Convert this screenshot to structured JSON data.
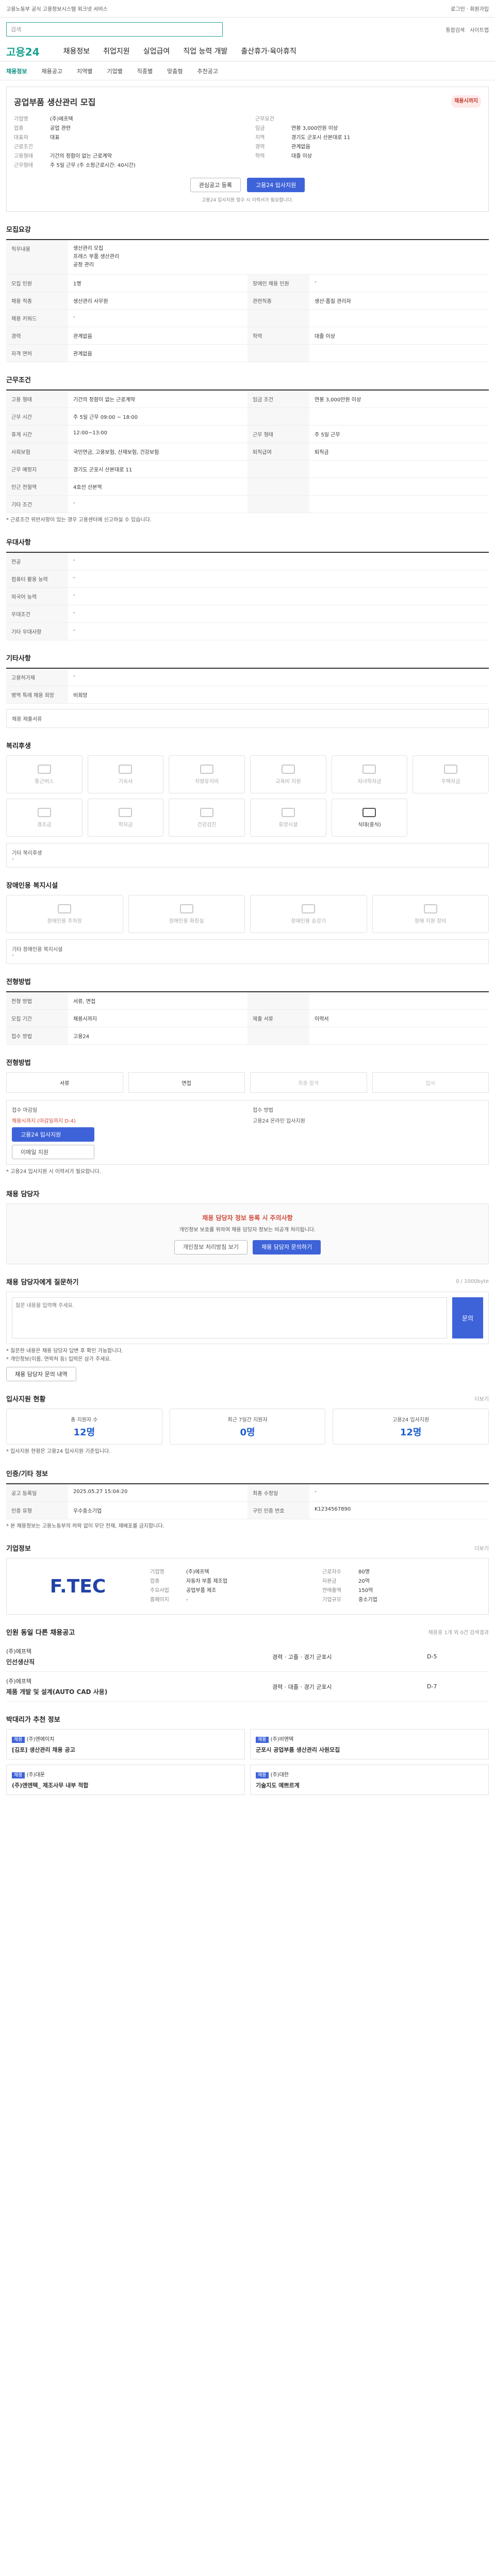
{
  "topbar": {
    "notice": "고용노동부 공식 고용정보시스템 워크넷 서비스",
    "right": "로그인 · 회원가입"
  },
  "search": {
    "placeholder": "검색"
  },
  "header": {
    "logo": "고용24",
    "menu": [
      "채용정보",
      "취업지원",
      "실업급여",
      "직업 능력 개발",
      "출산휴가·육아휴직"
    ],
    "links": [
      "통합검색",
      "사이트맵"
    ]
  },
  "subnav": [
    "채용정보",
    "채용공고",
    "지역별",
    "기업별",
    "직종별",
    "맞춤형",
    "추천공고"
  ],
  "job": {
    "title": "공업부품 생산관리 모집",
    "badge": "채용시까지",
    "left": [
      {
        "k": "기업명",
        "v": "(주)에프텍"
      },
      {
        "k": "업종",
        "v": "공업 관련"
      },
      {
        "k": "대표자",
        "v": "대표"
      },
      {
        "k": "근로조건",
        "v": ""
      },
      {
        "k": "고용형태",
        "v": "기간의 정함이 없는 근로계약"
      },
      {
        "k": "근무형태",
        "v": "주 5일 근무 (주 소정근로시간: 40시간)"
      }
    ],
    "right": [
      {
        "k": "근무요건",
        "v": ""
      },
      {
        "k": "임금",
        "v": "연봉 3,000만원 이상"
      },
      {
        "k": "지역",
        "v": "경기도 군포시 산본대로 11"
      },
      {
        "k": "경력",
        "v": "관계없음"
      },
      {
        "k": "학력",
        "v": "대졸 이상"
      }
    ],
    "btn_favorite": "관심공고 등록",
    "btn_apply": "고용24 입사지원",
    "note": "고용24 입사지원 접수 시 이력서가 필요합니다."
  },
  "recruit": {
    "title": "모집요강",
    "duty_title": "직무내용",
    "duty": [
      "생산관리 모집",
      "프레스 부품 생산관리",
      "공정 관리"
    ],
    "rows": [
      [
        {
          "k": "모집 인원",
          "v": "1명"
        },
        {
          "k": "장애인 채용 인원",
          "v": "-"
        }
      ],
      [
        {
          "k": "채용 직종",
          "v": "생산관리 사무원"
        },
        {
          "k": "관련직종",
          "v": "생산·품질 관리자"
        }
      ],
      [
        {
          "k": "채용 키워드",
          "v": "-"
        },
        {
          "k": "",
          "v": ""
        }
      ],
      [
        {
          "k": "경력",
          "v": "관계없음"
        },
        {
          "k": "학력",
          "v": "대졸 이상"
        }
      ],
      [
        {
          "k": "자격 면허",
          "v": "관계없음"
        },
        {
          "k": "",
          "v": ""
        }
      ]
    ]
  },
  "conditions": {
    "title": "근무조건",
    "rows": [
      [
        {
          "k": "고용 형태",
          "v": "기간의 정함이 없는 근로계약"
        },
        {
          "k": "임금 조건",
          "v": "연봉 3,000만원 이상"
        }
      ],
      [
        {
          "k": "근무 시간",
          "v": "주 5일 근무 09:00 ~ 18:00"
        },
        {
          "k": "",
          "v": ""
        }
      ],
      [
        {
          "k": "휴게 시간",
          "v": "12:00~13:00"
        },
        {
          "k": "근무 형태",
          "v": "주 5일 근무"
        }
      ],
      [
        {
          "k": "사회보험",
          "v": "국민연금, 고용보험, 산재보험, 건강보험"
        },
        {
          "k": "퇴직급여",
          "v": "퇴직금"
        }
      ],
      [
        {
          "k": "근무 예정지",
          "v": "경기도 군포시 산본대로 11"
        },
        {
          "k": "",
          "v": ""
        }
      ],
      [
        {
          "k": "인근 전철역",
          "v": "4호선 산본역"
        },
        {
          "k": "",
          "v": ""
        }
      ],
      [
        {
          "k": "기타 조건",
          "v": "-"
        },
        {
          "k": "",
          "v": ""
        }
      ]
    ],
    "memo": "* 근로조건 위반사항이 있는 경우 고용센터에 신고하실 수 있습니다."
  },
  "special": {
    "title": "우대사항",
    "rows": [
      {
        "k": "전공",
        "v": "-"
      },
      {
        "k": "컴퓨터 활용 능력",
        "v": "-"
      },
      {
        "k": "외국어 능력",
        "v": "-"
      },
      {
        "k": "우대조건",
        "v": "-"
      },
      {
        "k": "기타 우대사항",
        "v": "-"
      }
    ]
  },
  "etc": {
    "title": "기타사항",
    "rows": [
      {
        "k": "고용허가제",
        "v": "-"
      },
      {
        "k": "병역 특례 채용 희망",
        "v": "비희망"
      }
    ],
    "extra": "채용 제출서류"
  },
  "welfare": {
    "title": "복리후생",
    "items": [
      {
        "label": "통근버스",
        "on": false
      },
      {
        "label": "기숙사",
        "on": false
      },
      {
        "label": "차량유지비",
        "on": false
      },
      {
        "label": "교육비 지원",
        "on": false
      },
      {
        "label": "자녀학자금",
        "on": false
      },
      {
        "label": "주택자금",
        "on": false
      },
      {
        "label": "경조금",
        "on": false
      },
      {
        "label": "학자금",
        "on": false
      },
      {
        "label": "건강검진",
        "on": false
      },
      {
        "label": "휴양시설",
        "on": false
      },
      {
        "label": "식대(중식)",
        "on": true
      }
    ],
    "etc_title": "기타 복리후생",
    "etc_value": "-"
  },
  "disabled": {
    "title": "장애인용 복지시설",
    "items": [
      "장애인용 주차장",
      "장애인용 화장실",
      "장애인용 승강기",
      "장애 지원 장비"
    ],
    "etc_title": "기타 장애인용 복지시설",
    "etc_value": "-"
  },
  "hiring": {
    "title": "전형방법",
    "rows": [
      [
        {
          "k": "전형 방법",
          "v": "서류, 면접"
        },
        {
          "k": "",
          "v": ""
        }
      ],
      [
        {
          "k": "모집 기간",
          "v": "채용시까지"
        },
        {
          "k": "제출 서류",
          "v": "이력서"
        }
      ],
      [
        {
          "k": "접수 방법",
          "v": "고용24"
        },
        {
          "k": "",
          "v": ""
        }
      ]
    ]
  },
  "apply": {
    "title": "전형방법",
    "steps": [
      "서류",
      "면접",
      "최종 합격",
      "입사"
    ],
    "period_label": "접수 마감일",
    "period_value": "채용시까지 (마감일까지 D-4)",
    "btn_apply": "고용24 입사지원",
    "btn_email": "이메일 지원",
    "contact_label": "접수 방법",
    "contact_value": "고용24 온라인 입사지원",
    "warn": "* 고용24 입사지원 시 이력서가 필요합니다."
  },
  "manager": {
    "title": "채용 담당자",
    "warn_title": "채용 담당자 정보 등록 시 주의사항",
    "warn_text": "개인정보 보호를 위하여 채용 담당자 정보는 비공개 처리됩니다.",
    "btn_private": "개인정보 처리방침 보기",
    "btn_contact": "채용 담당자 문의하기"
  },
  "qa": {
    "title": "채용 담당자에게 질문하기",
    "counter": "0 / 1000byte",
    "placeholder": "질문 내용을 입력해 주세요.",
    "send": "문의",
    "notes": [
      "* 질문한 내용은 채용 담당자 답변 후 확인 가능합니다.",
      "* 개인정보(이름, 연락처 등) 입력은 삼가 주세요."
    ],
    "btn_more": "채용 담당자 문의 내역"
  },
  "stats": {
    "title": "입사지원 현황",
    "link": "더보기",
    "items": [
      {
        "label": "총 지원자 수",
        "value": "12명"
      },
      {
        "label": "최근 7일간 지원자",
        "value": "0명"
      },
      {
        "label": "고용24 입사지원",
        "value": "12명"
      }
    ],
    "memo": "* 입사지원 현황은 고용24 입사지원 기준입니다."
  },
  "info": {
    "title": "인증/기타 정보",
    "rows": [
      [
        {
          "k": "공고 등록일",
          "v": "2025.05.27 15:04:20"
        },
        {
          "k": "최종 수정일",
          "v": "-"
        }
      ],
      [
        {
          "k": "인증 유형",
          "v": "우수중소기업"
        },
        {
          "k": "구인 인증 번호",
          "v": "K1234567890"
        }
      ]
    ],
    "memo": "* 본 채용정보는 고용노동부의 허락 없이 무단 전재, 재배포를 금지합니다."
  },
  "company": {
    "title": "기업정보",
    "link": "더보기",
    "logo": "F.TEC",
    "left": [
      {
        "k": "기업명",
        "v": "(주)에프텍"
      },
      {
        "k": "업종",
        "v": "자동차 부품 제조업"
      },
      {
        "k": "주요사업",
        "v": "공업부품 제조"
      },
      {
        "k": "홈페이지",
        "v": "-"
      }
    ],
    "right": [
      {
        "k": "근로자수",
        "v": "80명"
      },
      {
        "k": "자본금",
        "v": "20억"
      },
      {
        "k": "연매출액",
        "v": "150억"
      },
      {
        "k": "기업규모",
        "v": "중소기업"
      }
    ]
  },
  "company_jobs": {
    "title": "인원 동일 다른 채용공고",
    "link": "채용중 1개 외 0건 검색결과",
    "items": [
      {
        "company": "(주)에프텍",
        "title": "인선생산직",
        "meta": "경력 · 고졸 · 경기 군포시",
        "date": "D-5"
      },
      {
        "company": "(주)에프텍",
        "title": "제품 개발 및 설계(AUTO CAD 사용)",
        "meta": "경력 · 대졸 · 경기 군포시",
        "date": "D-7"
      }
    ]
  },
  "recommend": {
    "title": "박대리가 추천 정보",
    "items": [
      {
        "tag": "채용",
        "company": "(주)엔에이치",
        "title": "[김포] 생산관리 채용 공고"
      },
      {
        "tag": "채용",
        "company": "(주)비엔텍",
        "title": "군포시 공업부품 생산관리 사원모집"
      },
      {
        "tag": "채용",
        "company": "(주)대운",
        "title": "(주)엔엔텍_ 제조사무 내부 적합"
      },
      {
        "tag": "채용",
        "company": "(주)대한",
        "title": "기술지도 예쁘르계"
      }
    ]
  }
}
